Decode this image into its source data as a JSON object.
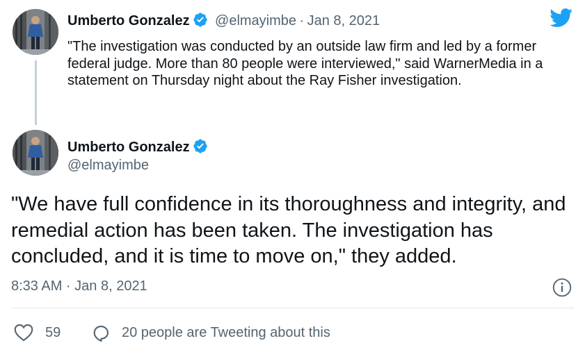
{
  "tweet1": {
    "name": "Umberto Gonzalez",
    "handle": "@elmayimbe",
    "separator": "·",
    "date": "Jan 8, 2021",
    "text": "\"The investigation was conducted by an outside law firm and led by a former federal judge. More than 80 people were interviewed,\" said WarnerMedia in a statement on Thursday night about the Ray Fisher investigation."
  },
  "tweet2": {
    "name": "Umberto Gonzalez",
    "handle": "@elmayimbe",
    "text": "\"We have full confidence in its thoroughness and integrity, and remedial action has been taken. The investigation has concluded, and it is time to move on,\" they added.",
    "timestamp": "8:33 AM · Jan 8, 2021",
    "like_count": "59",
    "tweeting_text": "20 people are Tweeting about this"
  },
  "icons": {
    "brand": "twitter-bird-icon",
    "verified": "verified-badge-icon",
    "info": "info-icon",
    "like": "heart-icon",
    "reply": "speech-bubble-icon"
  },
  "colors": {
    "twitter_blue": "#1da1f2",
    "text_primary": "#0f1419",
    "text_secondary": "#536471",
    "thread_line": "#c4cfd6",
    "divider": "#e1e8ed"
  }
}
